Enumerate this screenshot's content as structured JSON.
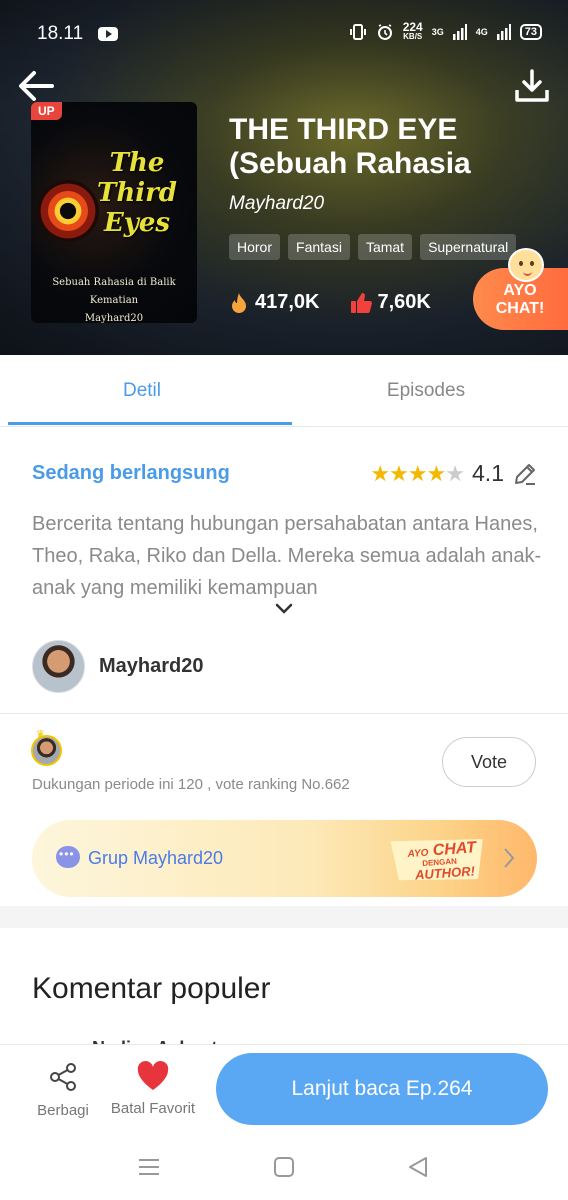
{
  "status_bar": {
    "time": "18.11",
    "speed_value": "224",
    "speed_unit": "KB/S",
    "network_1": "3G",
    "network_2": "4G",
    "battery": "73"
  },
  "book": {
    "badge": "UP",
    "cover_title": "The Third Eyes",
    "cover_subtitle_1": "Sebuah Rahasia di Balik",
    "cover_subtitle_2": "Kematian",
    "cover_author": "Mayhard20",
    "title": "THE THIRD EYE (Sebuah Rahasia",
    "author": "Mayhard20",
    "tags": [
      "Horor",
      "Fantasi",
      "Tamat",
      "Supernatural"
    ],
    "views": "417,0K",
    "likes": "7,60K"
  },
  "ayo_chat": {
    "line1": "AYO",
    "line2": "CHAT!"
  },
  "tabs": [
    {
      "label": "Detil",
      "active": true
    },
    {
      "label": "Episodes",
      "active": false
    }
  ],
  "detail": {
    "status": "Sedang berlangsung",
    "rating_value": "4.1",
    "rating_fraction": 0.82,
    "synopsis": "Bercerita tentang hubungan persahabatan antara Hanes, Theo, Raka, Riko dan Della. Mereka semua adalah anak-anak yang memiliki kemampuan",
    "author_name": "Mayhard20"
  },
  "support": {
    "text": "Dukungan periode ini 120 , vote ranking No.662",
    "vote_label": "Vote"
  },
  "group": {
    "label": "Grup Mayhard20",
    "badge_ayo": "AYO",
    "badge_chat": "CHAT",
    "badge_dengan": "DENGAN",
    "badge_author": "AUTHOR!"
  },
  "comments": {
    "title": "Komentar populer",
    "first_commenter_peek": "Nadine Ashanty"
  },
  "bottom_bar": {
    "share_label": "Berbagi",
    "favorite_label": "Batal Favorit",
    "read_label": "Lanjut baca Ep.264"
  },
  "colors": {
    "accent": "#4a9be8",
    "read_button": "#5aa8f3",
    "star": "#f5b800",
    "heart": "#e8343c"
  }
}
